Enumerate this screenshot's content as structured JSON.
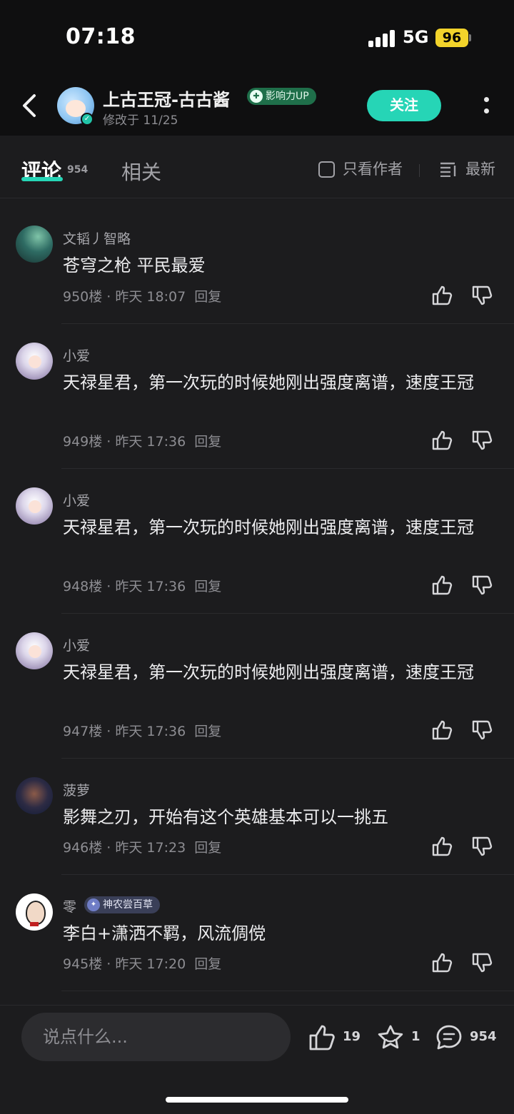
{
  "status_bar": {
    "time": "07:18",
    "network": "5G",
    "battery": "96"
  },
  "header": {
    "author_name": "上古王冠-古古酱",
    "influence_badge": "影响力UP",
    "modified": "修改于 11/25",
    "follow_label": "关注"
  },
  "tabs": {
    "comments_label": "评论",
    "comments_count": "954",
    "related_label": "相关",
    "only_author_label": "只看作者",
    "sort_label": "最新"
  },
  "comments": [
    {
      "user": "文韬丿智略",
      "text": "苍穹之枪  平民最爱",
      "floor": "950楼",
      "time": "昨天 18:07",
      "reply": "回复"
    },
    {
      "user": "小爱",
      "text": "天禄星君，第一次玩的时候她刚出强度离谱，速度王冠",
      "floor": "949楼",
      "time": "昨天 17:36",
      "reply": "回复"
    },
    {
      "user": "小爱",
      "text": "天禄星君，第一次玩的时候她刚出强度离谱，速度王冠",
      "floor": "948楼",
      "time": "昨天 17:36",
      "reply": "回复"
    },
    {
      "user": "小爱",
      "text": "天禄星君，第一次玩的时候她刚出强度离谱，速度王冠",
      "floor": "947楼",
      "time": "昨天 17:36",
      "reply": "回复"
    },
    {
      "user": "菠萝",
      "text": "影舞之刃，开始有这个英雄基本可以一挑五",
      "floor": "946楼",
      "time": "昨天 17:23",
      "reply": "回复"
    },
    {
      "user": "零",
      "medal": "神农尝百草",
      "text": "李白+潇洒不羁，风流倜傥",
      "floor": "945楼",
      "time": "昨天 17:20",
      "reply": "回复"
    }
  ],
  "bottom_bar": {
    "input_placeholder": "说点什么...",
    "likes": "19",
    "favorites": "1",
    "comments": "954"
  },
  "colors": {
    "accent": "#26d5b6",
    "background": "#1c1c1e",
    "header": "#0f0f10"
  },
  "icons": [
    "back-icon",
    "verified-icon",
    "more-icon",
    "checkbox-icon",
    "sort-icon",
    "like-icon",
    "dislike-icon",
    "star-icon",
    "comment-icon"
  ]
}
